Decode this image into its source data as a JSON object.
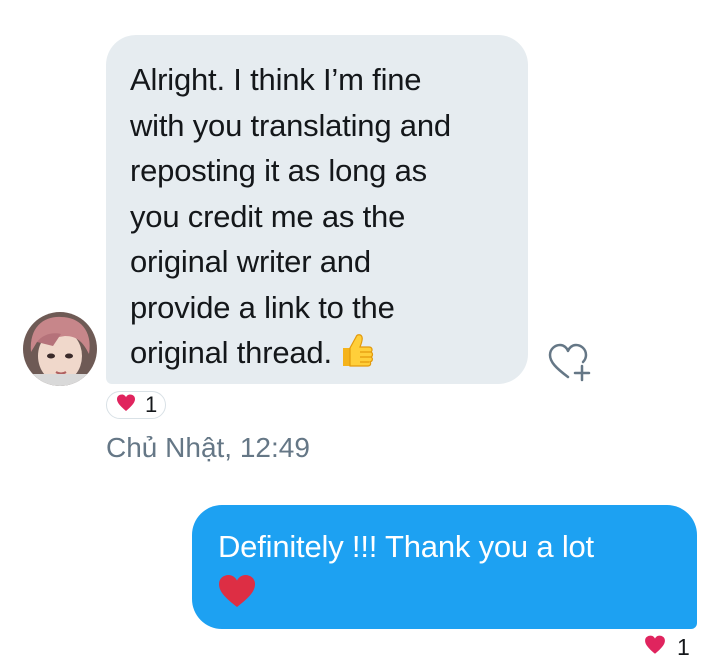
{
  "incoming_message": {
    "lines": [
      "Alright. I think I’m fine",
      "with you translating and",
      "reposting it as long as",
      "you credit me as the",
      "original writer and",
      "provide a link to the",
      "original thread."
    ],
    "emoji": "thumbs-up-icon",
    "reaction": {
      "icon": "heart-icon",
      "count": "1"
    }
  },
  "timestamp": "Chủ Nhật, 12:49",
  "outgoing_message": {
    "text": "Definitely !!! Thank you a lot",
    "emoji": "red-heart-icon",
    "reaction": {
      "icon": "heart-icon",
      "count": "1"
    }
  },
  "colors": {
    "incoming_bubble": "#e6ecf0",
    "outgoing_bubble": "#1da1f2",
    "heart": "#e0245e",
    "timestamp": "#657786"
  }
}
